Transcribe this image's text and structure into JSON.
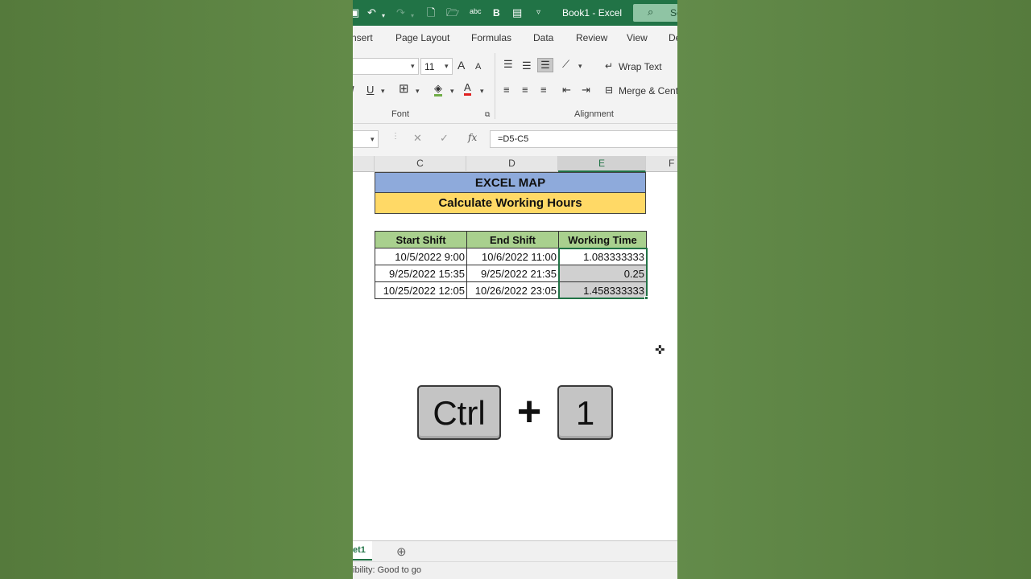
{
  "titlebar": {
    "title": "Book1  -  Excel",
    "search_label": "Se",
    "icons": [
      "save-icon",
      "undo-icon",
      "redo-icon",
      "new-file-icon",
      "open-folder-icon",
      "spelling-icon",
      "bold-icon",
      "form-icon",
      "customize-qat-icon",
      "search-icon"
    ],
    "spelling_glyph": "abc",
    "bold_glyph": "B"
  },
  "tabs": [
    "nsert",
    "Page Layout",
    "Formulas",
    "Data",
    "Review",
    "View",
    "De"
  ],
  "ribbon": {
    "font_size": "11",
    "wrap_text": "Wrap Text",
    "merge_center": "Merge & Cente",
    "font_group_label": "Font",
    "alignment_group_label": "Alignment",
    "underline_glyph": "U",
    "italic_glyph": "I",
    "font_color_glyph": "A",
    "grow_font_glyph": "A",
    "shrink_font_glyph": "A"
  },
  "formula_bar": {
    "fx_label": "fx",
    "formula": "=D5-C5"
  },
  "columns": [
    "C",
    "D",
    "E",
    "F"
  ],
  "sheet": {
    "banner_title": "EXCEL MAP",
    "banner_subtitle": "Calculate Working Hours",
    "headers": [
      "Start Shift",
      "End Shift",
      "Working Time"
    ],
    "rows": [
      [
        "10/5/2022 9:00",
        "10/6/2022 11:00",
        "1.083333333"
      ],
      [
        "9/25/2022 15:35",
        "9/25/2022 21:35",
        "0.25"
      ],
      [
        "10/25/2022 12:05",
        "10/26/2022 23:05",
        "1.458333333"
      ]
    ]
  },
  "overlay": {
    "key1": "Ctrl",
    "plus": "+",
    "key2": "1"
  },
  "sheet_tab": "et1",
  "status": "ibility: Good to go",
  "colors": {
    "excel_green": "#217346",
    "banner_blue": "#8eaadb",
    "banner_yellow": "#ffd966",
    "header_green": "#a9d08e",
    "background_green": "#5e8244"
  }
}
